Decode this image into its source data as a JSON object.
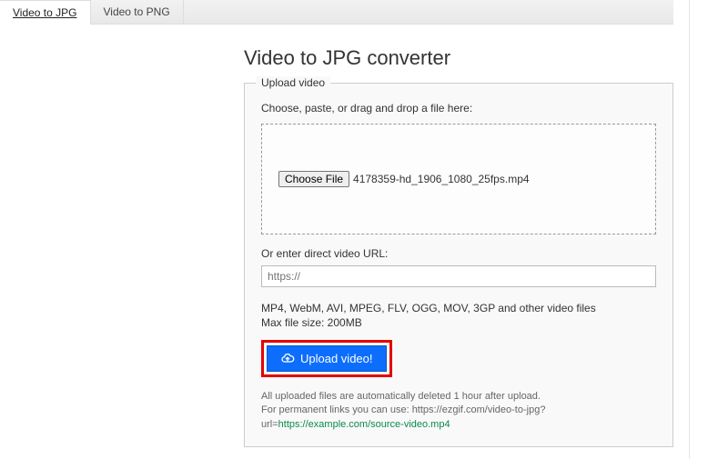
{
  "tabs": {
    "active": "Video to JPG",
    "inactive": "Video to PNG"
  },
  "page_title": "Video to JPG converter",
  "fieldset": {
    "legend": "Upload video",
    "instruction": "Choose, paste, or drag and drop a file here:",
    "choose_file_label": "Choose File",
    "selected_file": "4178359-hd_1906_1080_25fps.mp4",
    "url_label": "Or enter direct video URL:",
    "url_placeholder": "https://",
    "formats_text": "MP4, WebM, AVI, MPEG, FLV, OGG, MOV, 3GP and other video files",
    "maxsize_text": "Max file size: 200MB",
    "upload_button": "Upload video!",
    "fine_print_1": "All uploaded files are automatically deleted 1 hour after upload.",
    "fine_print_2": "For permanent links you can use: https://ezgif.com/video-to-jpg?url=",
    "fine_print_link": "https://example.com/source-video.mp4"
  }
}
